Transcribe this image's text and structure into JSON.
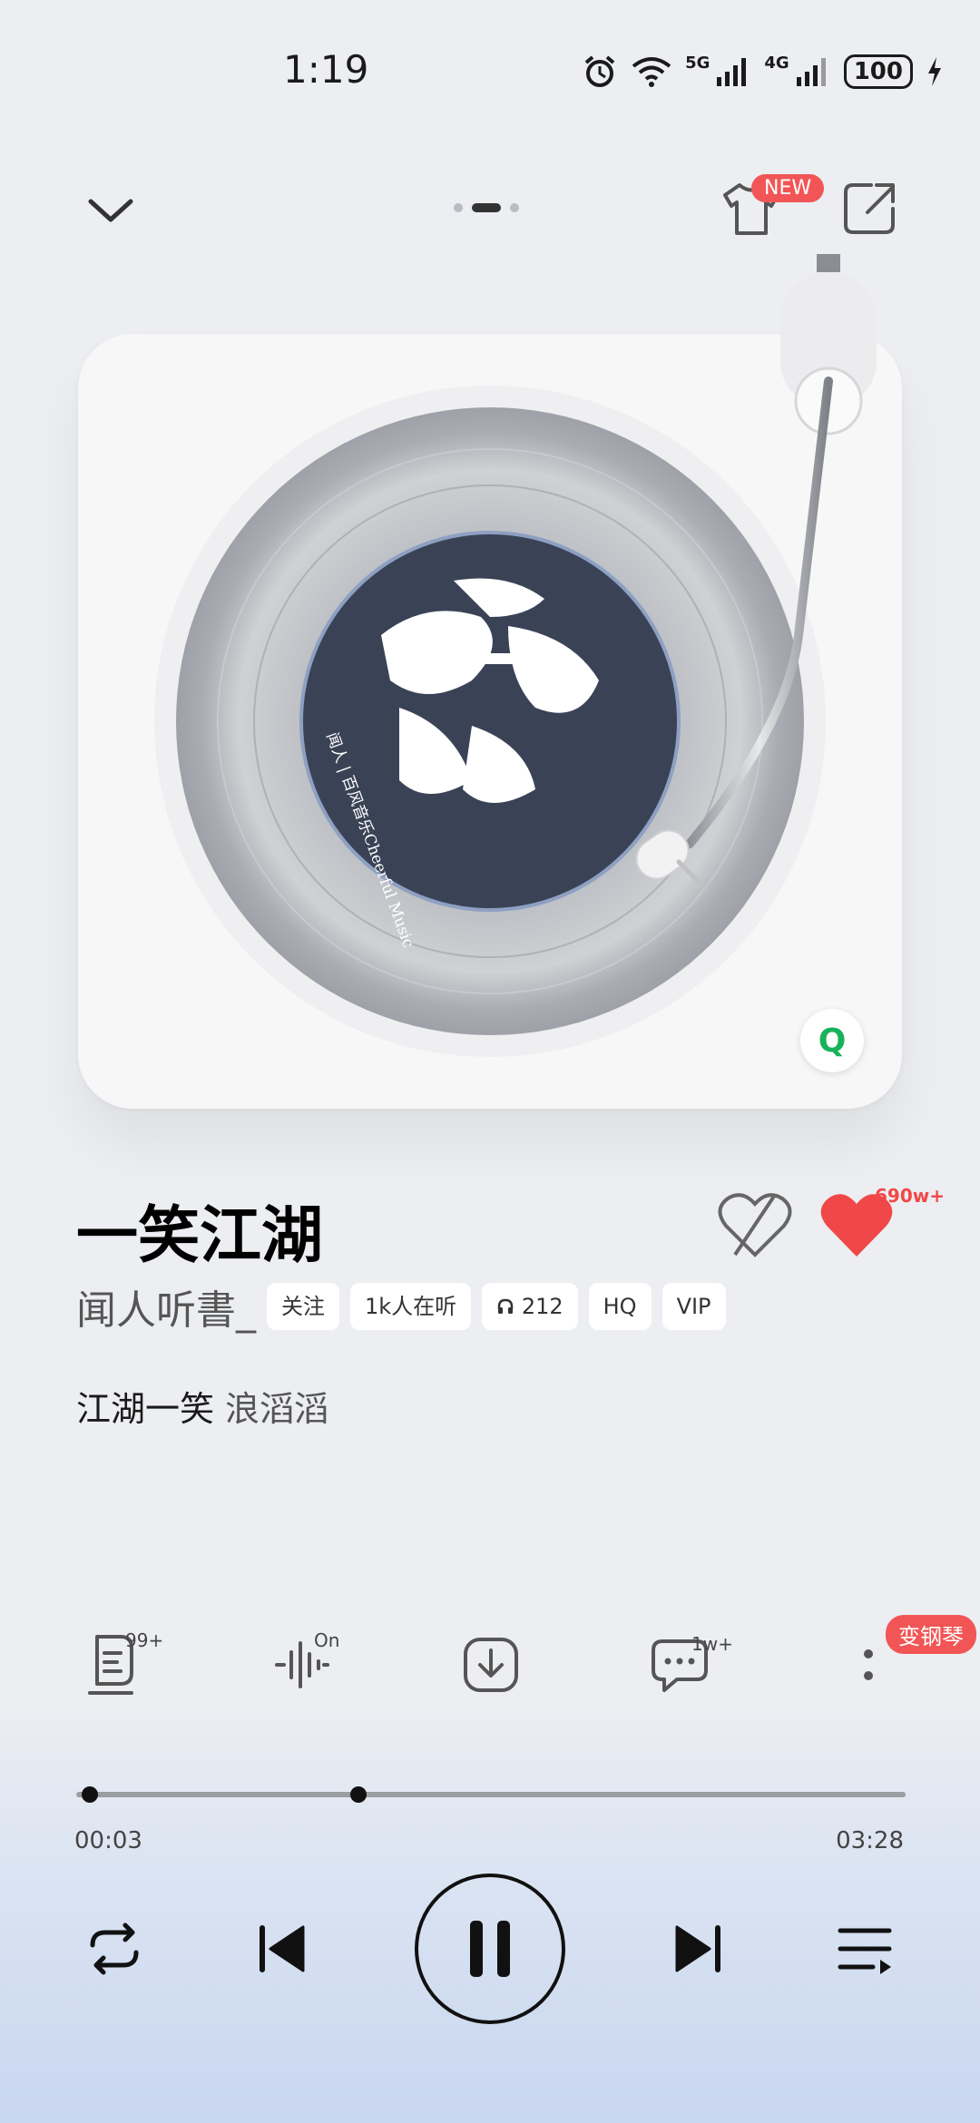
{
  "status_bar": {
    "time": "1:19",
    "net1": "5G",
    "net2": "4G",
    "battery": "100"
  },
  "top_bar": {
    "new_badge": "NEW",
    "page_count": 3,
    "active_page": 2
  },
  "album": {
    "label_text": "闻人 | 百风音乐Cheerful Music"
  },
  "song": {
    "title": "一笑江湖",
    "artist": "闻人听書_",
    "tags": [
      "关注",
      "1k人在听",
      "212",
      "HQ",
      "VIP"
    ],
    "like_count": "690w+",
    "lyric_main": "江湖一笑",
    "lyric_sub": "浪滔滔"
  },
  "features": {
    "lyrics_badge": "99+",
    "effect_badge": "On",
    "comments_badge": "1w+",
    "piano_badge": "变钢琴"
  },
  "progress": {
    "current": "00:03",
    "total": "03:28",
    "played_fraction": 0.016,
    "buffered_fraction": 0.34
  },
  "colors": {
    "accent_red": "#f25555",
    "heart_red": "#f04848",
    "label_navy": "#3a4356",
    "q_green": "#17b35a"
  }
}
